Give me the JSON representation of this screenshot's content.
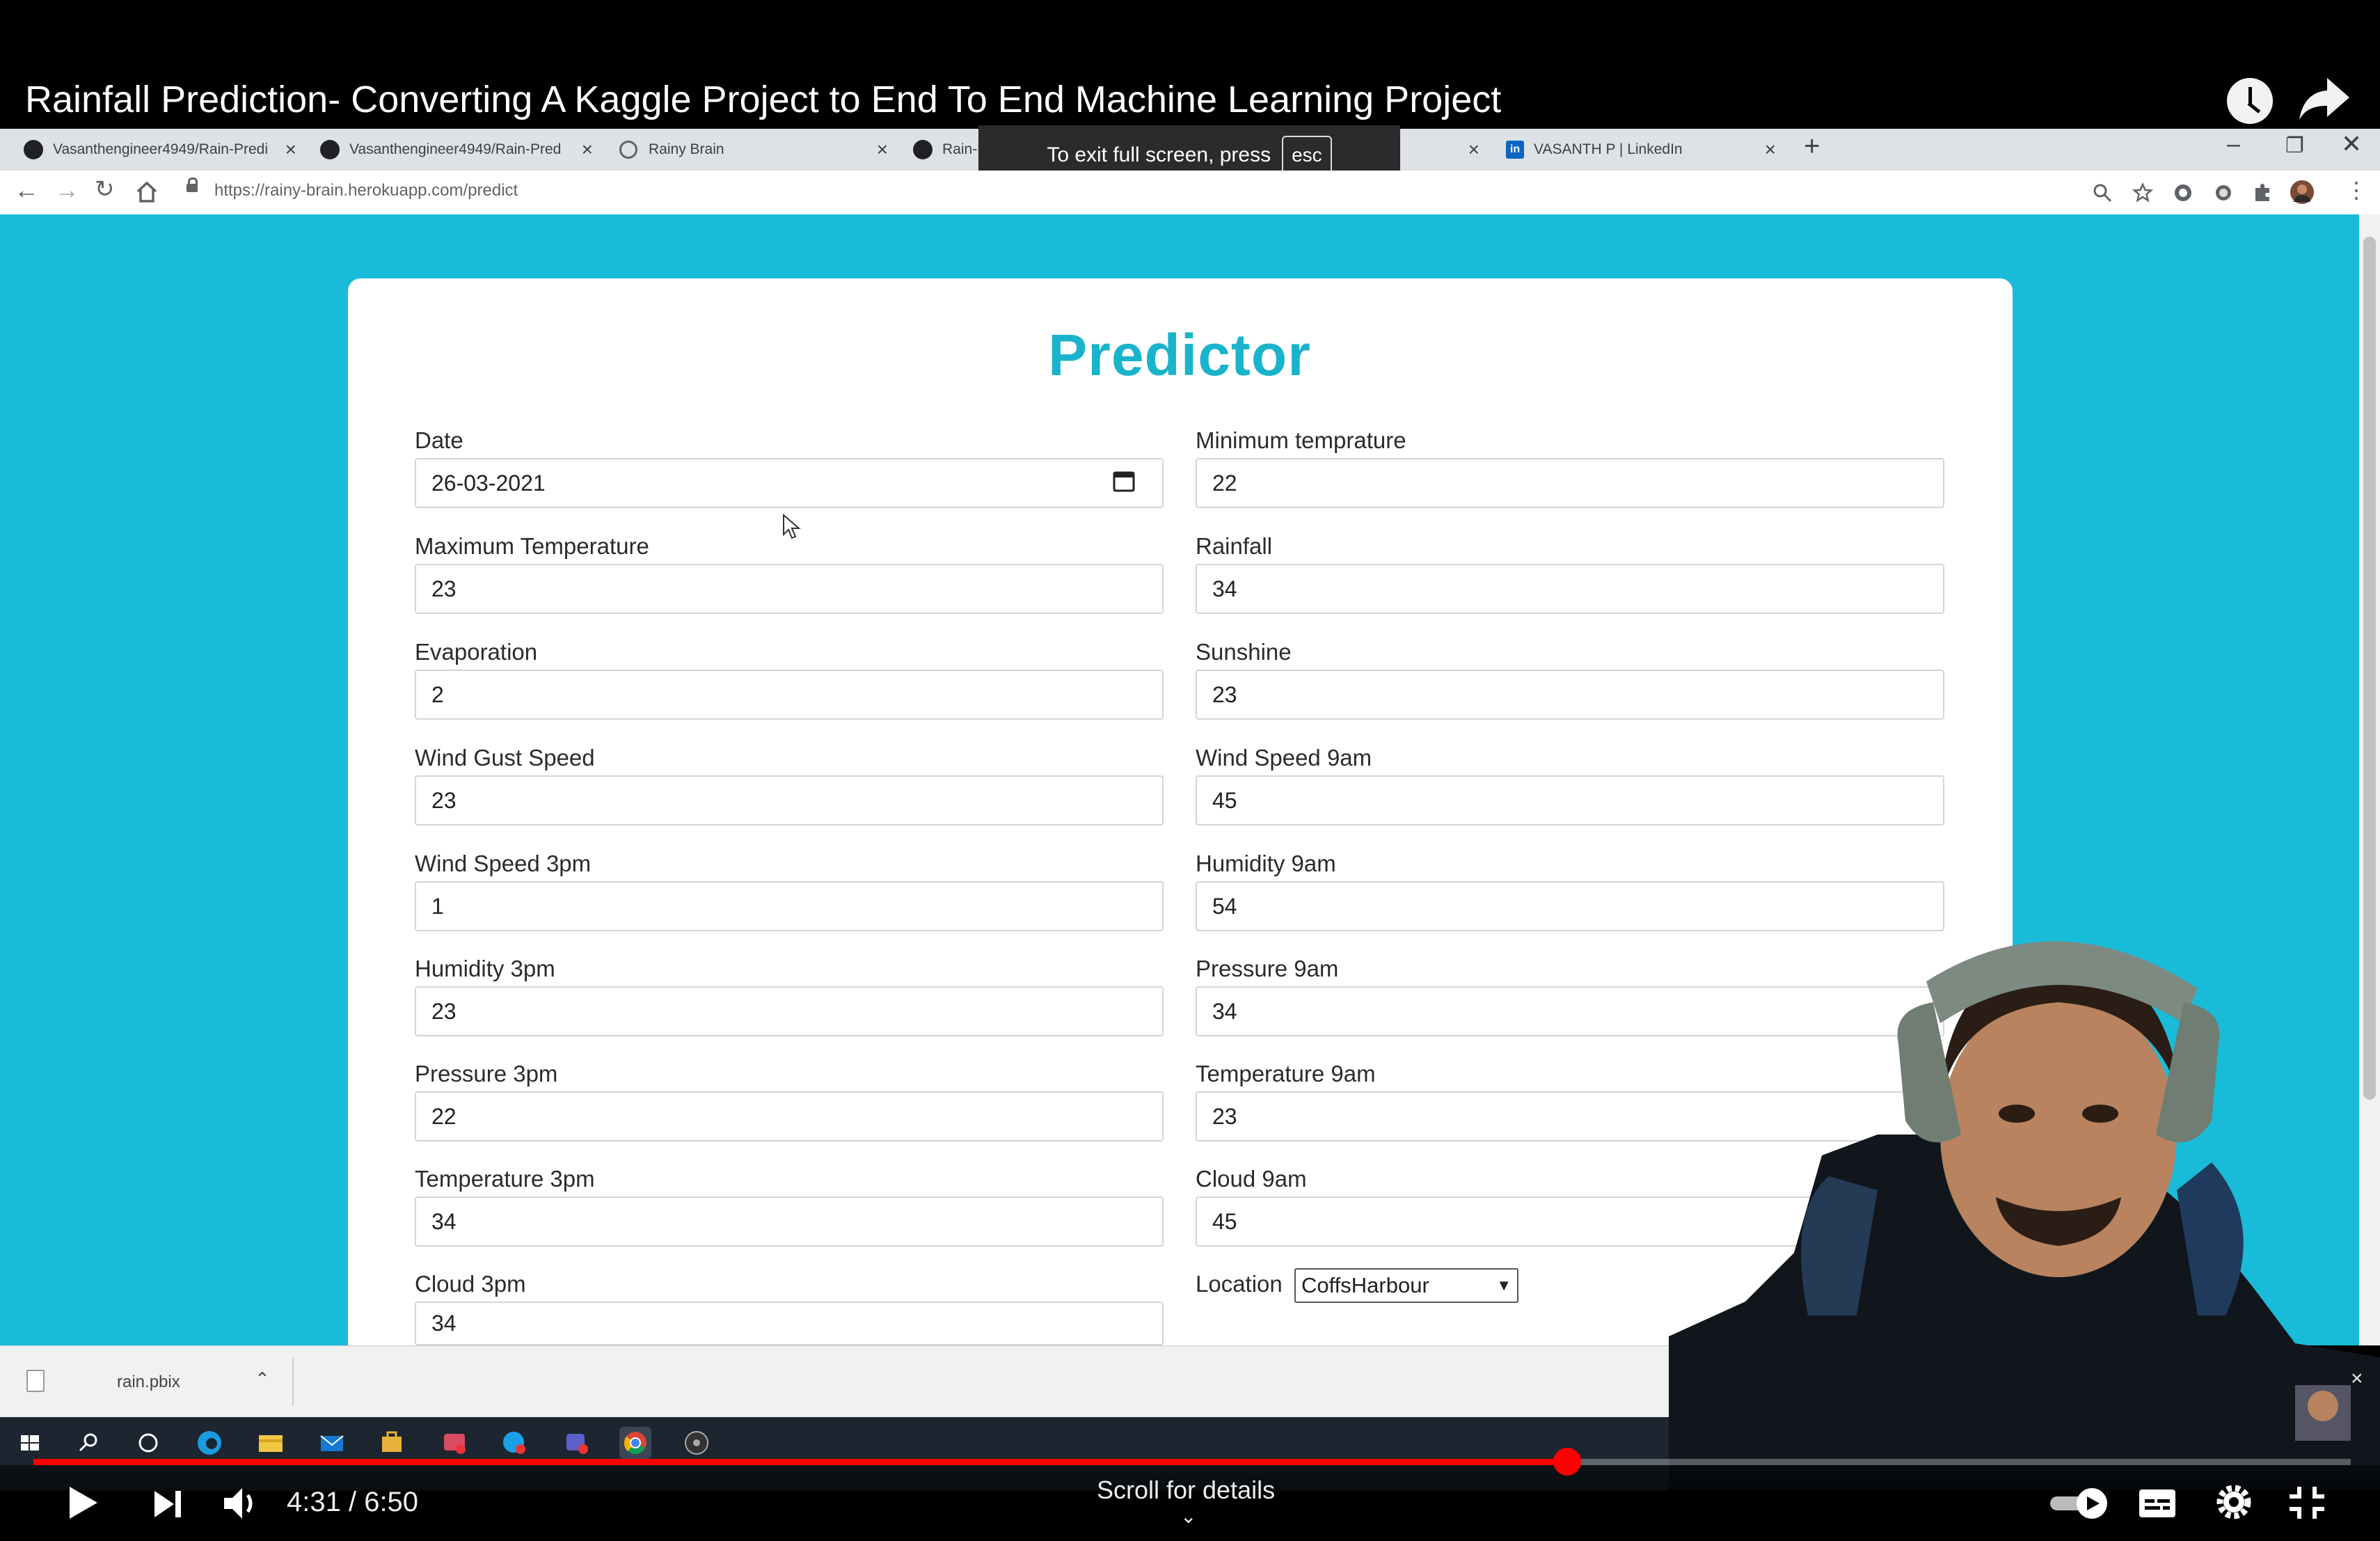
{
  "video": {
    "title": "Rainfall Prediction- Converting A Kaggle Project to End To End Machine Learning Project",
    "current_time": "4:31",
    "duration": "6:50",
    "time_display": "4:31 / 6:50",
    "progress_fraction": 0.662,
    "scroll_hint": "Scroll for details"
  },
  "browser": {
    "tabs": [
      {
        "label": "Vasanthengineer4949/Rain-Predi",
        "icon": "github-icon"
      },
      {
        "label": "Vasanthengineer4949/Rain-Pred",
        "icon": "github-icon"
      },
      {
        "label": "Rainy Brain",
        "icon": "globe-icon"
      },
      {
        "label": "Rain-Predi",
        "icon": "github-icon"
      },
      {
        "label": "VASANTH P | LinkedIn",
        "icon": "linkedin-icon"
      }
    ],
    "url": "https://rainy-brain.herokuapp.com/predict",
    "fullscreen_toast": "To exit full screen, press",
    "fullscreen_key": "esc"
  },
  "form": {
    "title": "Predictor",
    "left_fields": [
      {
        "label": "Date",
        "value": "26-03-2021"
      },
      {
        "label": "Maximum Temperature",
        "value": "23"
      },
      {
        "label": "Evaporation",
        "value": "2"
      },
      {
        "label": "Wind Gust Speed",
        "value": "23"
      },
      {
        "label": "Wind Speed 3pm",
        "value": "1"
      },
      {
        "label": "Humidity 3pm",
        "value": "23"
      },
      {
        "label": "Pressure 3pm",
        "value": "22"
      },
      {
        "label": "Temperature 3pm",
        "value": "34"
      },
      {
        "label": "Cloud 3pm",
        "value": "34"
      }
    ],
    "right_fields": [
      {
        "label": "Minimum temprature",
        "value": "22"
      },
      {
        "label": "Rainfall",
        "value": "34"
      },
      {
        "label": "Sunshine",
        "value": "23"
      },
      {
        "label": "Wind Speed 9am",
        "value": "45"
      },
      {
        "label": "Humidity 9am",
        "value": "54"
      },
      {
        "label": "Pressure 9am",
        "value": "34"
      },
      {
        "label": "Temperature 9am",
        "value": "23"
      },
      {
        "label": "Cloud 9am",
        "value": "45"
      }
    ],
    "location_label": "Location",
    "location_value": "CoffsHarbour"
  },
  "download_shelf": {
    "filename": "rain.pbix"
  },
  "colors": {
    "page_bg": "#19bcd8",
    "title_accent": "#19b4cc",
    "progress": "#ff0000"
  }
}
